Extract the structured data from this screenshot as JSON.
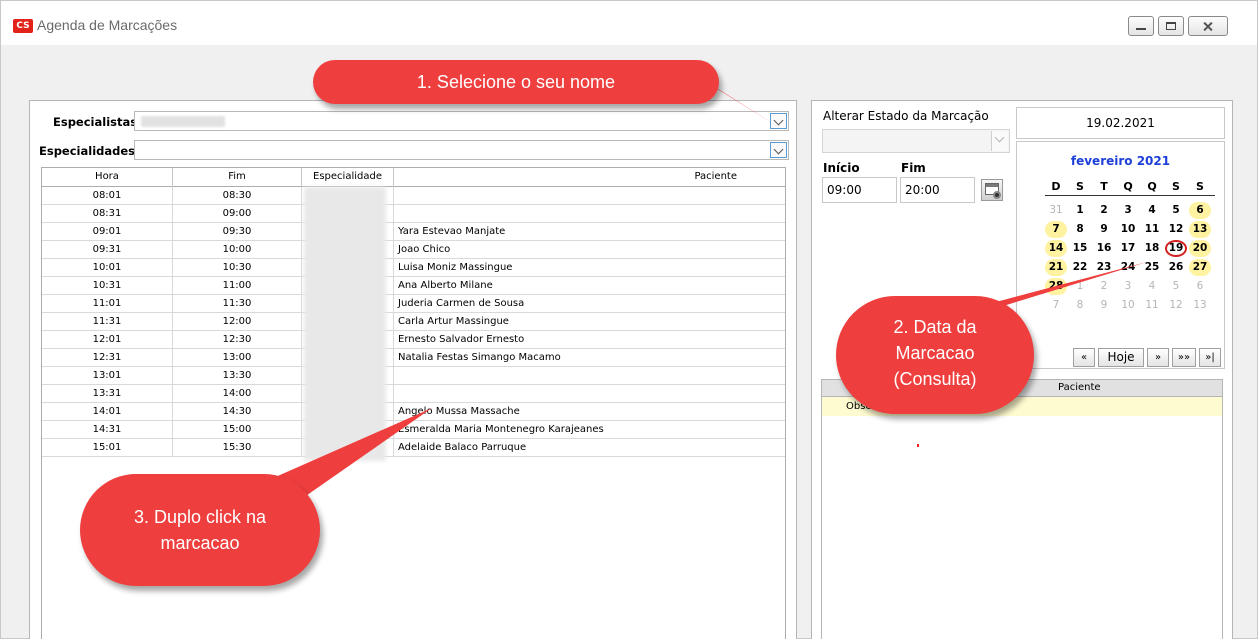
{
  "window": {
    "app_icon": "CS",
    "title": "Agenda de Marcações"
  },
  "left": {
    "especialistas_label": "Especialistas",
    "especialidades_label": "Especialidades",
    "especialidades_value": "",
    "columns": [
      "Hora",
      "Fim",
      "Especialidade",
      "Paciente"
    ],
    "rows": [
      {
        "hora": "08:01",
        "fim": "08:30",
        "paciente": ""
      },
      {
        "hora": "08:31",
        "fim": "09:00",
        "paciente": ""
      },
      {
        "hora": "09:01",
        "fim": "09:30",
        "paciente": "Yara Estevao Manjate"
      },
      {
        "hora": "09:31",
        "fim": "10:00",
        "paciente": "Joao Chico"
      },
      {
        "hora": "10:01",
        "fim": "10:30",
        "paciente": "Luisa Moniz Massingue"
      },
      {
        "hora": "10:31",
        "fim": "11:00",
        "paciente": "Ana Alberto Milane"
      },
      {
        "hora": "11:01",
        "fim": "11:30",
        "paciente": "Juderia Carmen de Sousa"
      },
      {
        "hora": "11:31",
        "fim": "12:00",
        "paciente": "Carla Artur Massingue"
      },
      {
        "hora": "12:01",
        "fim": "12:30",
        "paciente": "Ernesto Salvador Ernesto"
      },
      {
        "hora": "12:31",
        "fim": "13:00",
        "paciente": "Natalia Festas Simango Macamo"
      },
      {
        "hora": "13:01",
        "fim": "13:30",
        "paciente": ""
      },
      {
        "hora": "13:31",
        "fim": "14:00",
        "paciente": ""
      },
      {
        "hora": "14:01",
        "fim": "14:30",
        "paciente": "Angelo Mussa Massache"
      },
      {
        "hora": "14:31",
        "fim": "15:00",
        "paciente": "Esmeralda Maria Montenegro Karajeanes"
      },
      {
        "hora": "15:01",
        "fim": "15:30",
        "paciente": "Adelaide Balaco Parruque"
      }
    ]
  },
  "right": {
    "estado_label": "Alterar Estado da Marcação",
    "inicio_label": "Início",
    "fim_label": "Fim",
    "inicio_value": "09:00",
    "fim_value": "20:00",
    "selected_date": "19.02.2021",
    "calendar": {
      "month_title": "fevereiro 2021",
      "weekdays": [
        "D",
        "S",
        "T",
        "Q",
        "Q",
        "S",
        "S"
      ],
      "today_day": "19",
      "weeks": [
        [
          "31",
          "1",
          "2",
          "3",
          "4",
          "5",
          "6"
        ],
        [
          "7",
          "8",
          "9",
          "10",
          "11",
          "12",
          "13"
        ],
        [
          "14",
          "15",
          "16",
          "17",
          "18",
          "19",
          "20"
        ],
        [
          "21",
          "22",
          "23",
          "24",
          "25",
          "26",
          "27"
        ],
        [
          "28",
          "1",
          "2",
          "3",
          "4",
          "5",
          "6"
        ],
        [
          "7",
          "8",
          "9",
          "10",
          "11",
          "12",
          "13"
        ]
      ]
    },
    "nav": {
      "prev": "«",
      "today": "Hoje",
      "next": "»",
      "next_fast": "»»",
      "last": "»|"
    },
    "table_header": "Paciente",
    "table_row": "Obse"
  },
  "callouts": {
    "one": "1. Selecione o seu nome",
    "two_line1": "2. Data da",
    "two_line2": "Marcacao",
    "two_line3": "(Consulta)",
    "three_line1": "3. Duplo click na",
    "three_line2": "marcacao"
  },
  "colors": {
    "callout": "#ef3e3e",
    "weekend_highlight": "#fff2a0",
    "today_circle": "#d21f1f",
    "month_title": "#1e40d8",
    "note_row": "#fffbd0"
  }
}
